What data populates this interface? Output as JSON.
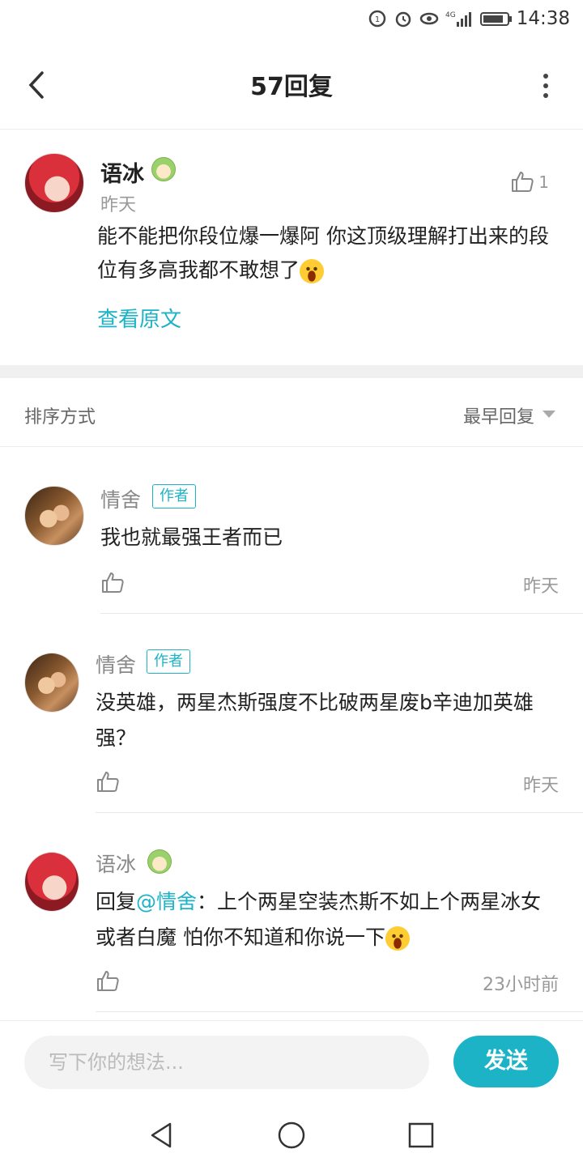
{
  "status_bar": {
    "time": "14:38",
    "network": "4G"
  },
  "header": {
    "title": "57回复"
  },
  "main_comment": {
    "author": "语冰",
    "time": "昨天",
    "like_count": "1",
    "text": "能不能把你段位爆一爆阿 你这顶级理解打出来的段位有多高我都不敢想了",
    "view_original": "查看原文"
  },
  "sort": {
    "label": "排序方式",
    "value": "最早回复"
  },
  "replies": [
    {
      "author": "情舍",
      "tag": "作者",
      "text": "我也就最强王者而已",
      "time": "昨天"
    },
    {
      "author": "情舍",
      "tag": "作者",
      "text": "没英雄，两星杰斯强度不比破两星废b辛迪加英雄强？",
      "time": "昨天"
    },
    {
      "author": "语冰",
      "reply_prefix": "回复",
      "mention": "@情舍",
      "text": "：上个两星空装杰斯不如上个两星冰女或者白魔 怕你不知道和你说一下",
      "time": "23小时前"
    }
  ],
  "input": {
    "placeholder": "写下你的想法..."
  },
  "send_button": {
    "label": "发送"
  },
  "colors": {
    "accent": "#1db3c7",
    "muted": "#999999"
  }
}
